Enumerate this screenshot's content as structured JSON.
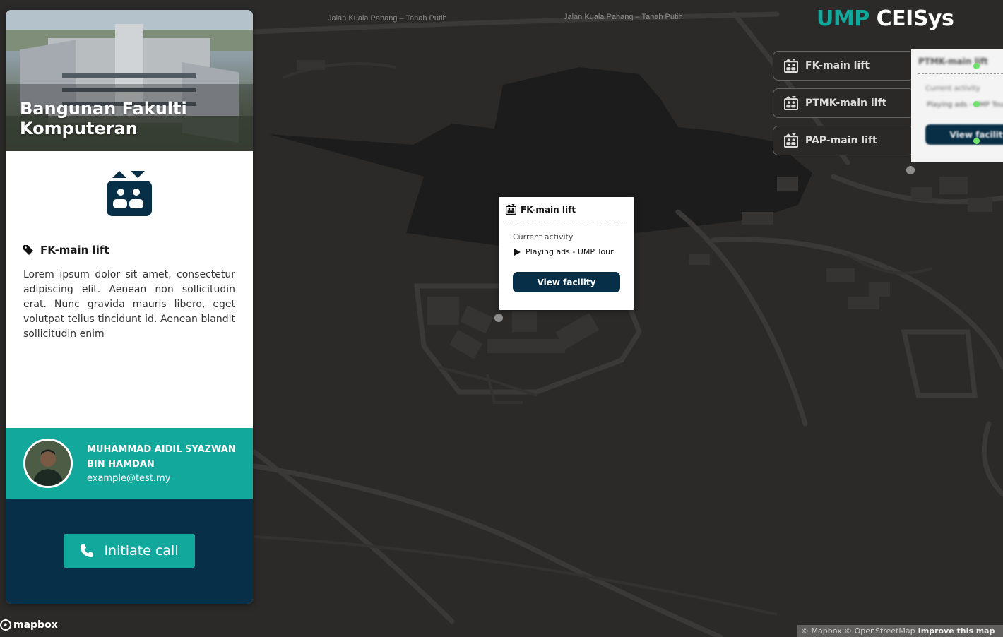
{
  "map": {
    "road_labels": [
      "Jalan Kuala Pahang – Tanah Putih",
      "Jalan Kuala Pahang – Tanah Putih"
    ]
  },
  "card": {
    "hero_title": "Bangunan Fakulti Komputeran",
    "facility_name": "FK-main lift",
    "description": "Lorem ipsum dolor sit amet, consectetur adipiscing elit. Aenean non sollicitudin erat. Nunc gravida mauris libero, eget volutpat tellus tincidunt id. Aenean blandit sollicitudin enim",
    "contact_name": "MUHAMMAD AIDIL SYAZWAN BIN HAMDAN",
    "contact_email": "example@test.my",
    "call_label": "Initiate call"
  },
  "popup": {
    "title": "FK-main lift",
    "subtitle": "Current activity",
    "activity": "Playing ads - UMP Tour",
    "button": "View facility"
  },
  "brand": {
    "part1": "UMP",
    "part2": "CEISys"
  },
  "lift_list": [
    {
      "label": "FK-main lift"
    },
    {
      "label": "PTMK-main lift"
    },
    {
      "label": "PAP-main lift"
    }
  ],
  "ghost_popup": {
    "title": "PTMK-main lift",
    "subtitle": "Current activity",
    "activity": "Playing ads - UMP Tour",
    "button": "View facility"
  },
  "footer": {
    "logo": "mapbox",
    "attribution": "© Mapbox © OpenStreetMap",
    "improve": "Improve this map"
  },
  "colors": {
    "teal": "#12a89c",
    "navy": "#072f48",
    "map_bg": "#2b2a29",
    "status": "#6ee36e"
  }
}
